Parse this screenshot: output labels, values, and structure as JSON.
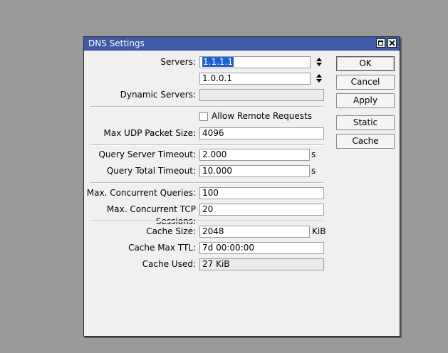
{
  "window": {
    "title": "DNS Settings"
  },
  "form": {
    "servers_label": "Servers:",
    "server1": "1.1.1.1",
    "server2": "1.0.0.1",
    "dynamic_servers_label": "Dynamic Servers:",
    "dynamic_servers": "",
    "allow_remote_label": "Allow Remote Requests",
    "allow_remote_checked": false,
    "max_udp_label": "Max UDP Packet Size:",
    "max_udp": "4096",
    "query_server_timeout_label": "Query Server Timeout:",
    "query_server_timeout": "2.000",
    "query_server_timeout_unit": "s",
    "query_total_timeout_label": "Query Total Timeout:",
    "query_total_timeout": "10.000",
    "query_total_timeout_unit": "s",
    "max_concurrent_queries_label": "Max. Concurrent Queries:",
    "max_concurrent_queries": "100",
    "max_tcp_sessions_label": "Max. Concurrent TCP Sessions:",
    "max_tcp_sessions": "20",
    "cache_size_label": "Cache Size:",
    "cache_size": "2048",
    "cache_size_unit": "KiB",
    "cache_max_ttl_label": "Cache Max TTL:",
    "cache_max_ttl": "7d 00:00:00",
    "cache_used_label": "Cache Used:",
    "cache_used": "27 KiB"
  },
  "buttons": {
    "ok": "OK",
    "cancel": "Cancel",
    "apply": "Apply",
    "static": "Static",
    "cache": "Cache"
  },
  "icons": {
    "maximize": "maximize-icon",
    "close": "close-icon",
    "updown": "up-down-arrow-icon"
  },
  "colors": {
    "titlebar": "#3f5aa6",
    "selection": "#1b5fd3",
    "desktop": "#9a9a9a"
  }
}
